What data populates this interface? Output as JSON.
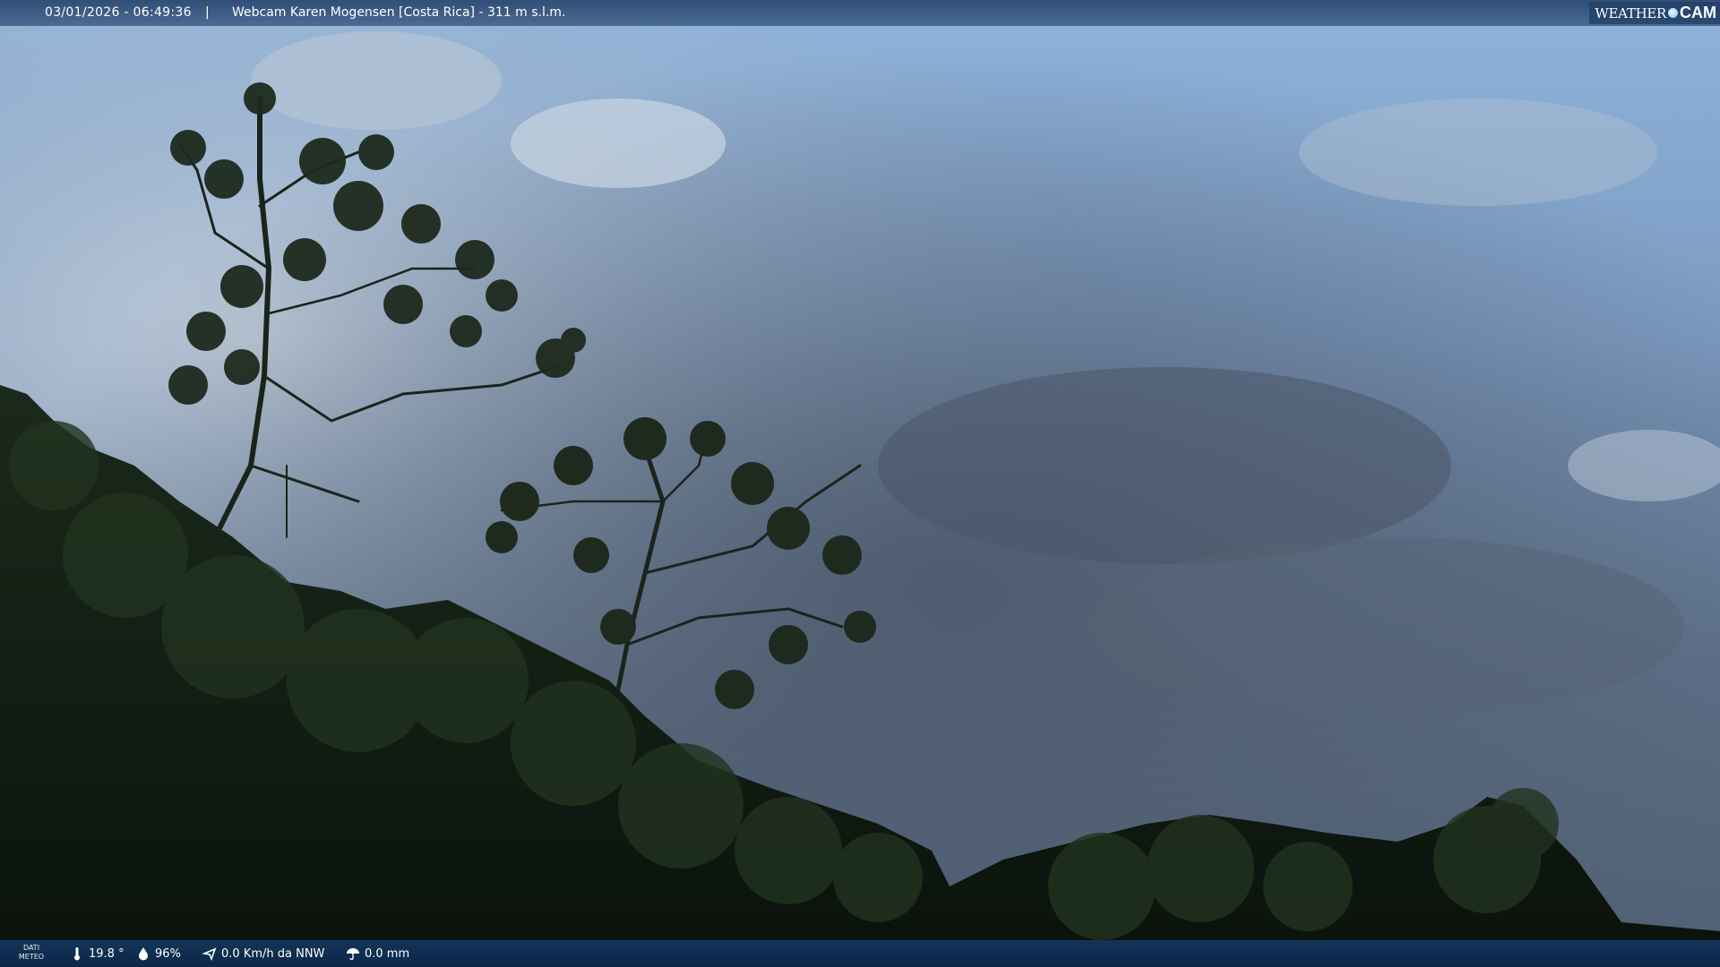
{
  "overlay": {
    "datetime": "03/01/2026 - 06:49:36",
    "separator": "|",
    "title": "Webcam Karen Mogensen [Costa Rica]  - 311 m s.l.m.",
    "brand": {
      "weather": "WEATHER",
      "cam": "CAM"
    }
  },
  "weather": {
    "label_line1": "DATI",
    "label_line2": "METEO",
    "temperature": "19.8 °",
    "humidity": "96%",
    "wind": "0.0 Km/h da NNW",
    "rain": "0.0 mm"
  },
  "icons": [
    "thermometer-icon",
    "humidity-drop-icon",
    "wind-icon",
    "rain-icon",
    "weathercam-globe-icon"
  ],
  "colors": {
    "sky_top": "#7fa7d3",
    "sky_clouds": "#5a6a80",
    "vegetation": "#0f1a10",
    "bar": "#1c3f66"
  }
}
